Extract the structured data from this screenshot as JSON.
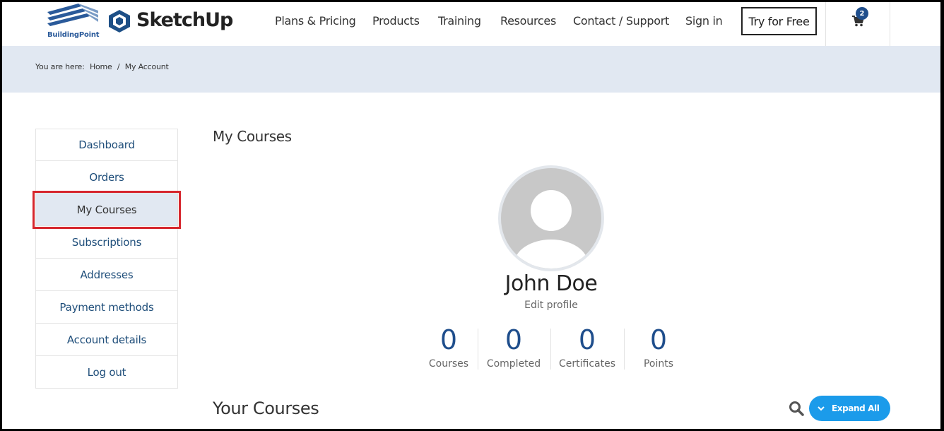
{
  "brand": {
    "partner": "BuildingPoint",
    "product": "SketchUp"
  },
  "nav": {
    "items": [
      "Plans & Pricing",
      "Products",
      "Training",
      "Resources",
      "Contact / Support",
      "Sign in"
    ],
    "cta": "Try for Free",
    "cart_count": "2"
  },
  "breadcrumb": {
    "prefix": "You are here:",
    "home": "Home",
    "separator": "/",
    "current": "My Account"
  },
  "sidebar": {
    "items": [
      "Dashboard",
      "Orders",
      "My Courses",
      "Subscriptions",
      "Addresses",
      "Payment methods",
      "Account details",
      "Log out"
    ],
    "active": "My Courses"
  },
  "main": {
    "section_title": "My Courses",
    "profile": {
      "name": "John Doe",
      "edit": "Edit profile"
    },
    "stats": [
      {
        "value": "0",
        "label": "Courses"
      },
      {
        "value": "0",
        "label": "Completed"
      },
      {
        "value": "0",
        "label": "Certificates"
      },
      {
        "value": "0",
        "label": "Points"
      }
    ],
    "your_courses_title": "Your Courses",
    "expand_label": "Expand All"
  },
  "colors": {
    "accent": "#1f4e8c",
    "highlight": "#d6262d",
    "band": "#e1e8f2",
    "button": "#1b9bea"
  }
}
